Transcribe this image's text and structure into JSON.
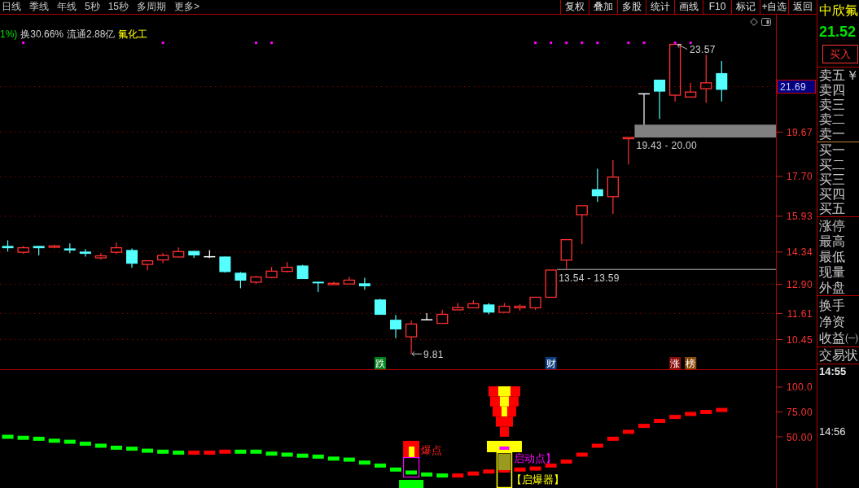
{
  "toolbar": {
    "periods": [
      "日线",
      "季线",
      "年线",
      "5秒",
      "15秒",
      "多周期",
      "更多>"
    ],
    "buttons": [
      "复权",
      "叠加",
      "多股",
      "统计",
      "画线",
      "F10",
      "标记",
      "+自选",
      "返回"
    ]
  },
  "quote_header": {
    "change": "1%)",
    "falling": true,
    "turnover": "换30.66%",
    "float_shares": "流通2.88亿",
    "sector": "氟化工"
  },
  "price_chart": {
    "chart_data": [
      {
        "type": "candlestick",
        "categories": [
          null,
          null,
          null,
          null,
          null,
          null,
          null,
          null,
          null,
          null,
          null,
          null,
          null,
          null,
          null,
          null,
          null,
          null,
          null,
          null,
          null,
          null,
          null,
          null,
          "跌",
          null,
          null,
          null,
          null,
          null,
          null,
          null,
          null,
          null,
          null,
          "财",
          null,
          null,
          null,
          null,
          null,
          null,
          null,
          "涨",
          "榜",
          null,
          null,
          null,
          null,
          null
        ],
        "ohlc": [
          [
            14.61,
            14.86,
            14.36,
            14.51
          ],
          [
            14.33,
            14.61,
            14.26,
            14.53
          ],
          [
            14.61,
            14.61,
            14.19,
            14.51
          ],
          [
            14.55,
            14.65,
            14.51,
            14.61
          ],
          [
            14.5,
            14.72,
            14.29,
            14.41
          ],
          [
            14.36,
            14.47,
            14.14,
            14.26
          ],
          [
            14.08,
            14.29,
            14.0,
            14.17
          ],
          [
            14.33,
            14.76,
            14.25,
            14.53
          ],
          [
            14.43,
            14.5,
            13.64,
            13.82
          ],
          [
            13.79,
            13.95,
            13.53,
            13.95
          ],
          [
            13.99,
            14.29,
            13.85,
            14.19
          ],
          [
            14.12,
            14.54,
            14.12,
            14.36
          ],
          [
            14.39,
            14.39,
            14.08,
            14.19
          ],
          [
            14.13,
            14.43,
            14.07,
            14.13
          ],
          [
            14.14,
            14.14,
            13.42,
            13.45
          ],
          [
            13.42,
            13.45,
            12.73,
            13.07
          ],
          [
            13.0,
            13.28,
            12.92,
            13.23
          ],
          [
            13.21,
            13.67,
            13.17,
            13.49
          ],
          [
            13.48,
            13.89,
            13.43,
            13.66
          ],
          [
            13.74,
            13.77,
            13.14,
            13.14
          ],
          [
            13.02,
            13.02,
            12.56,
            12.95
          ],
          [
            12.89,
            13.02,
            12.89,
            12.95
          ],
          [
            12.92,
            13.24,
            12.92,
            13.09
          ],
          [
            12.95,
            13.2,
            12.66,
            12.82
          ],
          [
            12.23,
            12.26,
            11.55,
            11.55
          ],
          [
            11.33,
            11.54,
            10.51,
            10.9
          ],
          [
            10.57,
            11.29,
            9.81,
            11.14
          ],
          [
            11.33,
            11.62,
            11.33,
            11.33
          ],
          [
            11.17,
            11.77,
            11.17,
            11.57
          ],
          [
            11.77,
            12.08,
            11.77,
            11.87
          ],
          [
            11.86,
            12.19,
            11.86,
            12.04
          ],
          [
            12.01,
            12.07,
            11.57,
            11.65
          ],
          [
            11.66,
            12.07,
            11.66,
            11.93
          ],
          [
            11.86,
            12.01,
            11.73,
            11.93
          ],
          [
            11.86,
            12.33,
            11.77,
            12.33
          ],
          [
            12.33,
            13.54,
            12.33,
            13.54
          ],
          [
            13.98,
            14.89,
            13.59,
            14.89
          ],
          [
            16.0,
            16.4,
            14.69,
            16.4
          ],
          [
            17.13,
            18.04,
            16.57,
            16.82
          ],
          [
            16.8,
            18.43,
            16.03,
            17.67
          ],
          [
            19.4,
            19.43,
            18.23,
            19.43
          ],
          [
            21.37,
            21.37,
            20.0,
            21.37
          ],
          [
            22.0,
            22.0,
            20.25,
            21.47
          ],
          [
            21.31,
            23.57,
            21.03,
            23.57
          ],
          [
            21.23,
            21.86,
            21.23,
            21.45
          ],
          [
            21.6,
            23.11,
            20.97,
            21.86
          ],
          [
            22.29,
            22.83,
            21.03,
            21.55
          ],
          null,
          null,
          null
        ],
        "series": [
          {
            "type": "scatter",
            "color": "#ff00ff",
            "values": [
              null,
              23.64,
              null,
              null,
              null,
              null,
              null,
              null,
              null,
              null,
              23.64,
              null,
              null,
              null,
              null,
              null,
              23.64,
              23.64,
              null,
              null,
              null,
              null,
              null,
              null,
              null,
              null,
              null,
              null,
              null,
              null,
              null,
              null,
              null,
              null,
              23.64,
              23.64,
              23.64,
              23.64,
              23.64,
              null,
              23.64,
              23.64,
              null,
              23.64,
              23.64,
              null,
              null,
              null,
              null,
              null
            ]
          }
        ],
        "ylim": [
          9.13,
          24.89
        ],
        "yticks": [
          {
            "value": 10.45,
            "label": "10.45"
          },
          {
            "value": 11.61,
            "label": "11.61"
          },
          {
            "value": 12.9,
            "label": "12.90"
          },
          {
            "value": 14.34,
            "label": "14.34"
          },
          {
            "value": 15.93,
            "label": "15.93"
          },
          {
            "value": 17.7,
            "label": "17.70"
          },
          {
            "value": 19.67,
            "label": "19.67"
          }
        ],
        "grid": true,
        "ref_lines": [
          {
            "axis": "y",
            "value": 21.69,
            "label": "21.69",
            "color": "#a00000",
            "line_style": "dotted"
          }
        ],
        "bands": [
          {
            "axis": "y",
            "from": 19.43,
            "to": 20.0,
            "label": "19.43 - 20.00",
            "color": "#808080"
          },
          {
            "axis": "y",
            "from": 13.54,
            "to": 13.59,
            "label": "13.54 - 13.59",
            "color": "#808080"
          }
        ],
        "annotations": [
          "23.57",
          "9.81"
        ]
      }
    ],
    "tags": [
      {
        "color": "#00801a"
      },
      {
        "color": "#0a3c7d"
      },
      {
        "color": "#8b0a0a"
      },
      {
        "color": "#8b4a0a"
      }
    ]
  },
  "indicator": {
    "chart_data": [
      {
        "type": "scatter",
        "marker": "square",
        "categories": [
          null,
          null,
          null,
          null,
          null,
          null,
          null,
          null,
          null,
          null,
          null,
          null,
          null,
          null,
          null,
          null,
          null,
          null,
          null,
          null,
          null,
          null,
          null,
          null,
          null,
          null,
          null,
          null,
          null,
          null,
          null,
          null,
          null,
          null,
          null,
          null,
          null,
          null,
          null,
          null,
          null,
          null,
          null,
          null,
          null,
          null,
          null,
          null,
          null,
          null
        ],
        "series": [
          {
            "color": "#00ff00",
            "values": [
              50,
              49,
              48,
              46,
              45,
              43,
              41,
              39,
              38,
              36,
              35,
              34,
              null,
              null,
              null,
              35,
              35,
              33,
              32,
              31,
              30,
              28,
              27,
              24,
              21,
              17,
              14,
              12,
              11,
              null,
              null,
              null,
              null,
              null,
              null,
              null,
              null,
              null,
              null,
              null,
              null,
              null,
              null,
              null,
              null,
              null,
              null,
              null,
              null,
              null
            ]
          },
          {
            "color": "#ff0000",
            "values": [
              null,
              null,
              null,
              null,
              null,
              null,
              null,
              null,
              null,
              null,
              null,
              null,
              34,
              34,
              35,
              null,
              null,
              null,
              null,
              null,
              null,
              null,
              null,
              null,
              null,
              null,
              null,
              null,
              null,
              11,
              13,
              15,
              16,
              17,
              18,
              21,
              25,
              32,
              41,
              48,
              55,
              61,
              66,
              70,
              73,
              75,
              77,
              null,
              null,
              null
            ]
          }
        ],
        "ylim": [
          -1.6,
          117.2
        ],
        "yticks": [
          {
            "value": 50,
            "label": "50.00"
          },
          {
            "value": 75,
            "label": "75.00"
          },
          {
            "value": 100,
            "label": "100.0"
          }
        ]
      }
    ],
    "signal_days": [
      false,
      false,
      false,
      false,
      false,
      false,
      false,
      false,
      false,
      false,
      false,
      false,
      false,
      false,
      false,
      false,
      false,
      false,
      false,
      false,
      false,
      false,
      false,
      false,
      false,
      false,
      true,
      false,
      false,
      false,
      false,
      false,
      true,
      false,
      false,
      false,
      false,
      false,
      false,
      false,
      false,
      false,
      false,
      false,
      false,
      false,
      false
    ],
    "signals": [
      {
        "kind": "burst",
        "labels": [
          "爆点"
        ]
      },
      {
        "kind": "launch",
        "labels": [
          "启动点】",
          "【启爆器】"
        ]
      }
    ]
  },
  "quote_panel": {
    "name": "中欣氟",
    "price": "21.52",
    "falling": true,
    "buy_button": "买入",
    "asks": [
      {
        "label": "卖五",
        "note": "￥"
      },
      {
        "label": "卖四"
      },
      {
        "label": "卖三"
      },
      {
        "label": "卖二"
      },
      {
        "label": "卖一"
      }
    ],
    "bids": [
      {
        "label": "买一"
      },
      {
        "label": "买二"
      },
      {
        "label": "买三"
      },
      {
        "label": "买四"
      },
      {
        "label": "买五"
      }
    ],
    "stats": [
      "涨停",
      "最高",
      "最低",
      "现量",
      "外盘"
    ],
    "ratios": [
      "换手",
      "净资",
      "收益㈠"
    ],
    "status": "交易状",
    "times": [
      "14:55",
      "14:56"
    ]
  }
}
